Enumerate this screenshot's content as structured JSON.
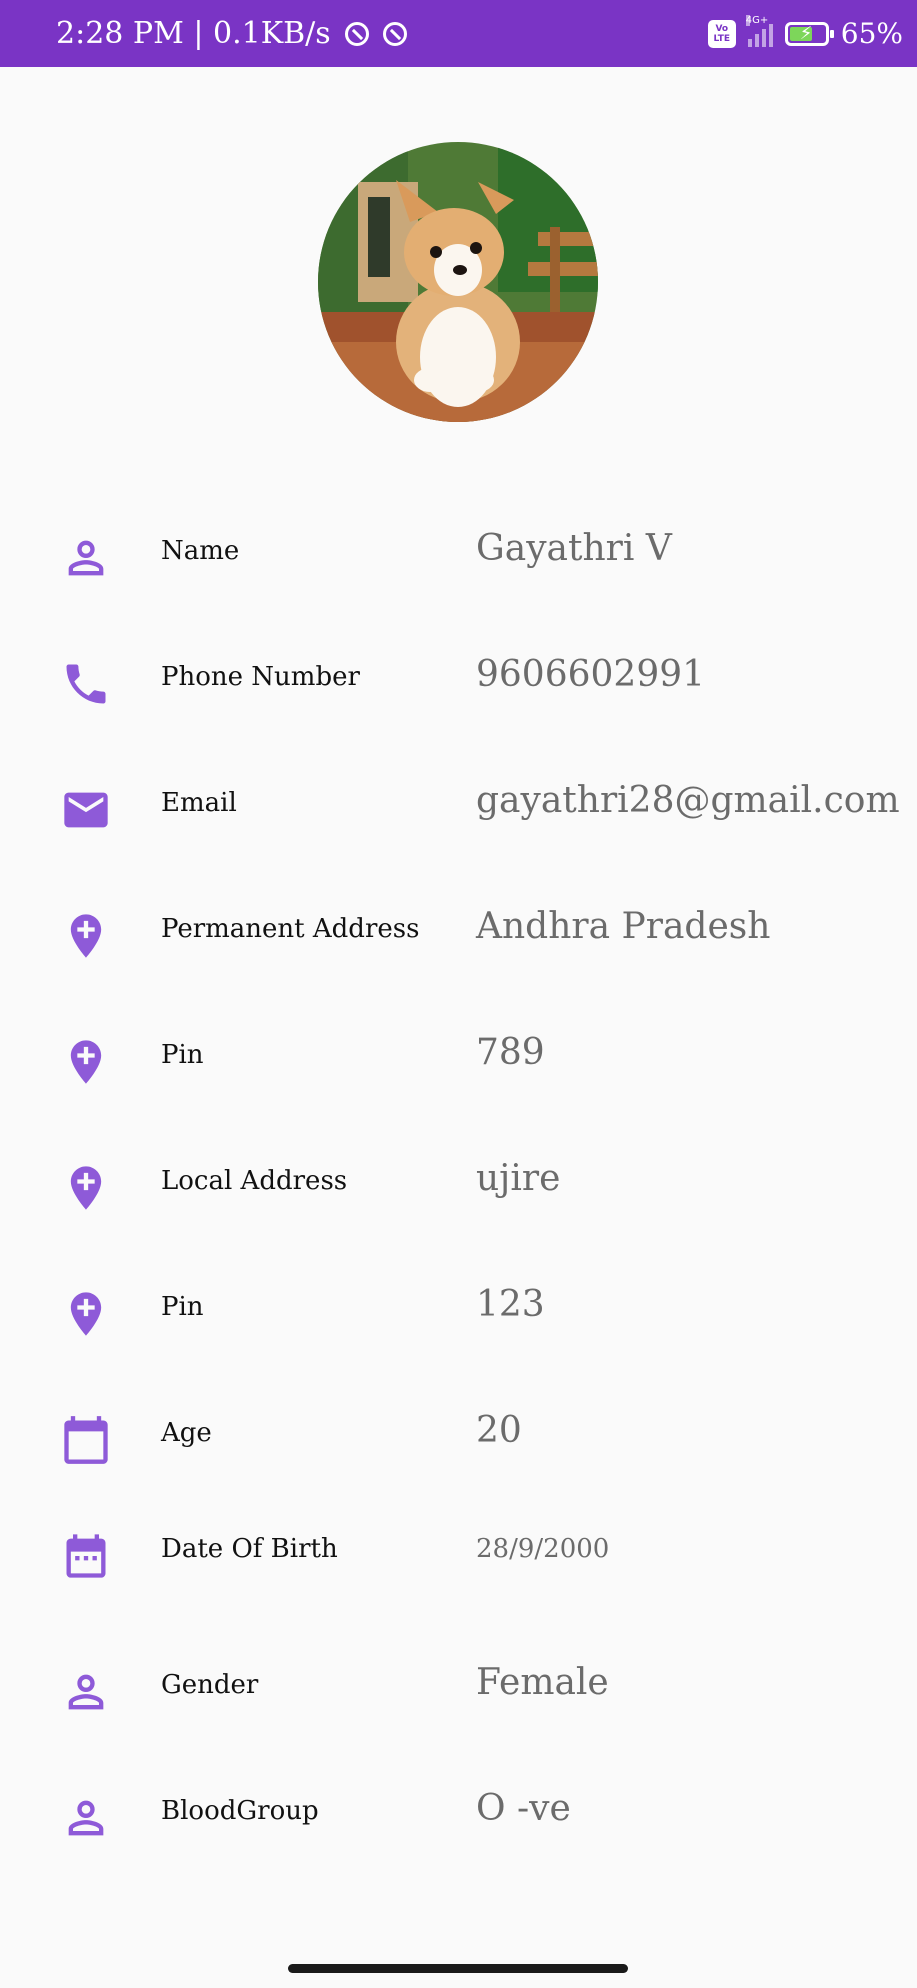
{
  "status_bar": {
    "time_speed": "2:28 PM | 0.1KB/s",
    "volte": "Vo LTE",
    "network": "4G+",
    "battery_percent": "65%",
    "battery_level": 0.65,
    "color": "#7a34c5"
  },
  "profile": {
    "avatar_icon": "corgi-dog-photo"
  },
  "accent_color": "#8e5ad8",
  "fields": [
    {
      "icon": "person-icon",
      "label": "Name",
      "value": "Gayathri V"
    },
    {
      "icon": "phone-icon",
      "label": "Phone Number",
      "value": "9606602991"
    },
    {
      "icon": "email-icon",
      "label": "Email",
      "value": "gayathri28@gmail.com"
    },
    {
      "icon": "add-location-icon",
      "label": "Permanent Address",
      "value": "Andhra Pradesh"
    },
    {
      "icon": "add-location-icon",
      "label": "Pin",
      "value": "789"
    },
    {
      "icon": "add-location-icon",
      "label": "Local Address",
      "value": "ujire"
    },
    {
      "icon": "add-location-icon",
      "label": "Pin",
      "value": "123"
    },
    {
      "icon": "calendar-icon",
      "label": "Age",
      "value": "20"
    },
    {
      "icon": "calendar-month-icon",
      "label": "Date Of Birth",
      "value": "28/9/2000"
    },
    {
      "icon": "person-icon",
      "label": "Gender",
      "value": "Female"
    },
    {
      "icon": "person-icon",
      "label": "BloodGroup",
      "value": "O -ve"
    }
  ]
}
